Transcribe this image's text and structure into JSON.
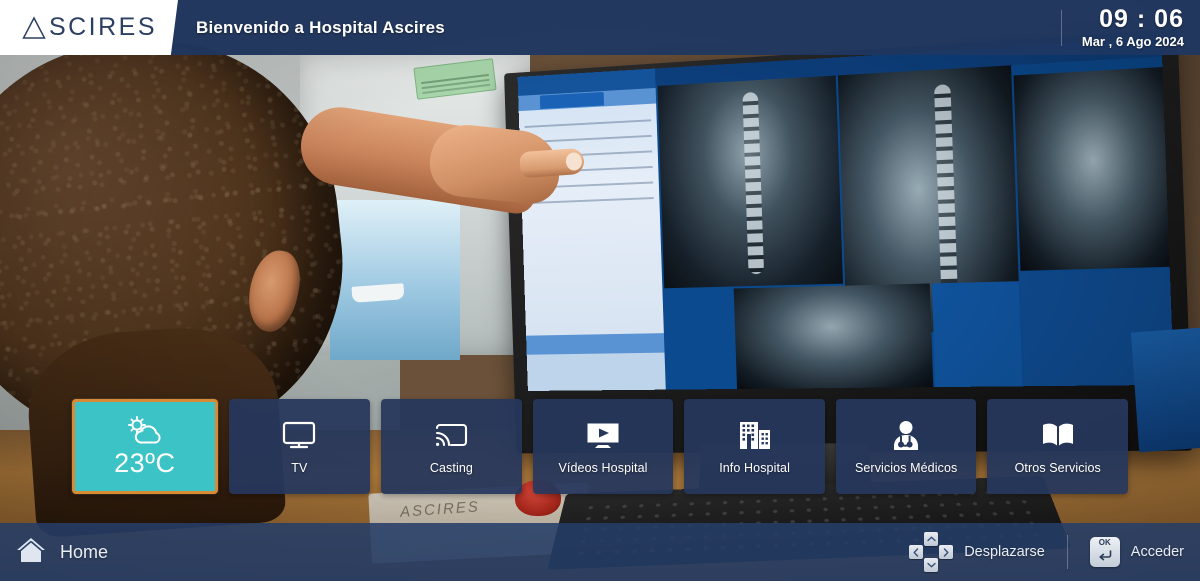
{
  "header": {
    "logo_text": "SCIRES",
    "logo_icon": "triangle-a-icon",
    "welcome_title": "Bienvenido a Hospital Ascires",
    "clock_time": "09 : 06",
    "clock_date": "Mar , 6 Ago 2024"
  },
  "tiles": [
    {
      "id": "weather",
      "label": "23ºC",
      "icon": "sun-cloud-icon",
      "selected": true,
      "bg_color": "#3cc3c6",
      "border_color": "#d98a35"
    },
    {
      "id": "tv",
      "label": "TV",
      "icon": "television-icon",
      "selected": false
    },
    {
      "id": "casting",
      "label": "Casting",
      "icon": "cast-screen-icon",
      "selected": false
    },
    {
      "id": "videos-hospital",
      "label": "Vídeos Hospital",
      "icon": "video-play-icon",
      "selected": false
    },
    {
      "id": "info-hospital",
      "label": "Info Hospital",
      "icon": "hospital-building-icon",
      "selected": false
    },
    {
      "id": "servicios-medicos",
      "label": "Servicios Médicos",
      "icon": "doctor-stethoscope-icon",
      "selected": false
    },
    {
      "id": "otros-servicios",
      "label": "Otros Servicios",
      "icon": "open-book-icon",
      "selected": false
    }
  ],
  "footer": {
    "home_label": "Home",
    "home_icon": "home-icon",
    "scroll_hint": "Desplazarse",
    "scroll_icon": "dpad-icon",
    "enter_hint": "Acceder",
    "enter_icon": "ok-enter-key-icon"
  },
  "colors": {
    "header_navy": "#1e3762",
    "tile_navy": "#26375c",
    "accent_teal": "#3cc3c6",
    "accent_orange": "#d98a35",
    "footer_navy": "#263e68",
    "text_white": "#ffffff"
  },
  "background": {
    "description_alt": "radiology-workstation-photo"
  }
}
